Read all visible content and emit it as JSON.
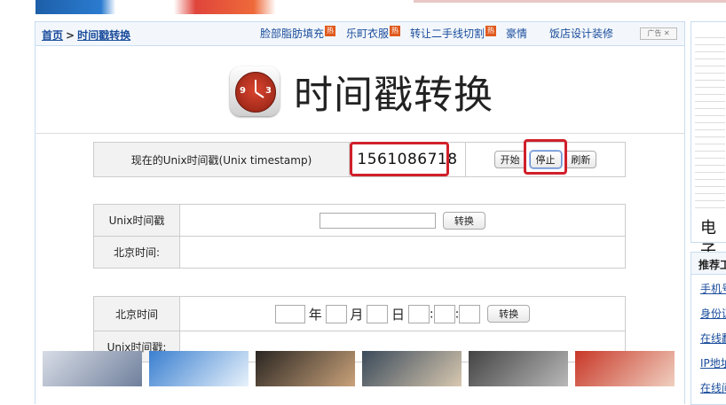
{
  "breadcrumb": {
    "home": "首页",
    "separator": ">",
    "current": "时间戳转换"
  },
  "ads": {
    "links": [
      {
        "label": "脸部脂肪填充",
        "hot": true
      },
      {
        "label": "乐町衣服",
        "hot": true
      },
      {
        "label": "转让二手线切割",
        "hot": true
      },
      {
        "label": "豪情",
        "hot": false
      },
      {
        "label": "饭店设计装修",
        "hot": false
      }
    ],
    "hot_badge": "热",
    "ad_label": "广告"
  },
  "header": {
    "title": "时间戳转换",
    "clock_numbers": [
      "9",
      "3"
    ]
  },
  "current_ts": {
    "label": "现在的Unix时间戳(Unix timestamp)",
    "value": "1561086718",
    "start_button": "开始",
    "stop_button": "停止",
    "refresh_button": "刷新"
  },
  "unix_to_beijing": {
    "input_label": "Unix时间戳",
    "input_value": "",
    "convert_button": "转换",
    "result_label": "北京时间:"
  },
  "beijing_to_unix": {
    "input_label": "北京时间",
    "year_unit": "年",
    "month_unit": "月",
    "day_unit": "日",
    "time_sep": ":",
    "convert_button": "转换",
    "result_label": "Unix时间戳:"
  },
  "thumbnails": [
    {
      "name": "thumb-1",
      "color_a": "#d8dde6",
      "color_b": "#6f7f9c"
    },
    {
      "name": "thumb-2",
      "color_a": "#3a7fd0",
      "color_b": "#e8f2fb"
    },
    {
      "name": "thumb-3",
      "color_a": "#2a2622",
      "color_b": "#c9a27a"
    },
    {
      "name": "thumb-4",
      "color_a": "#3a4a5a",
      "color_b": "#d8c8b0"
    },
    {
      "name": "thumb-5",
      "color_a": "#444444",
      "color_b": "#b8b8b8"
    },
    {
      "name": "thumb-6",
      "color_a": "#c83828",
      "color_b": "#f0d0c0"
    }
  ],
  "sidebar": {
    "top_title": "电子",
    "box_title": "推荐工",
    "links": [
      "手机号",
      "身份证",
      "在线翻",
      "IP地址",
      "在线间"
    ]
  },
  "colors": {
    "highlight_frame": "#d0202a",
    "link": "#1a4c9c",
    "border": "#c8dcf0"
  }
}
